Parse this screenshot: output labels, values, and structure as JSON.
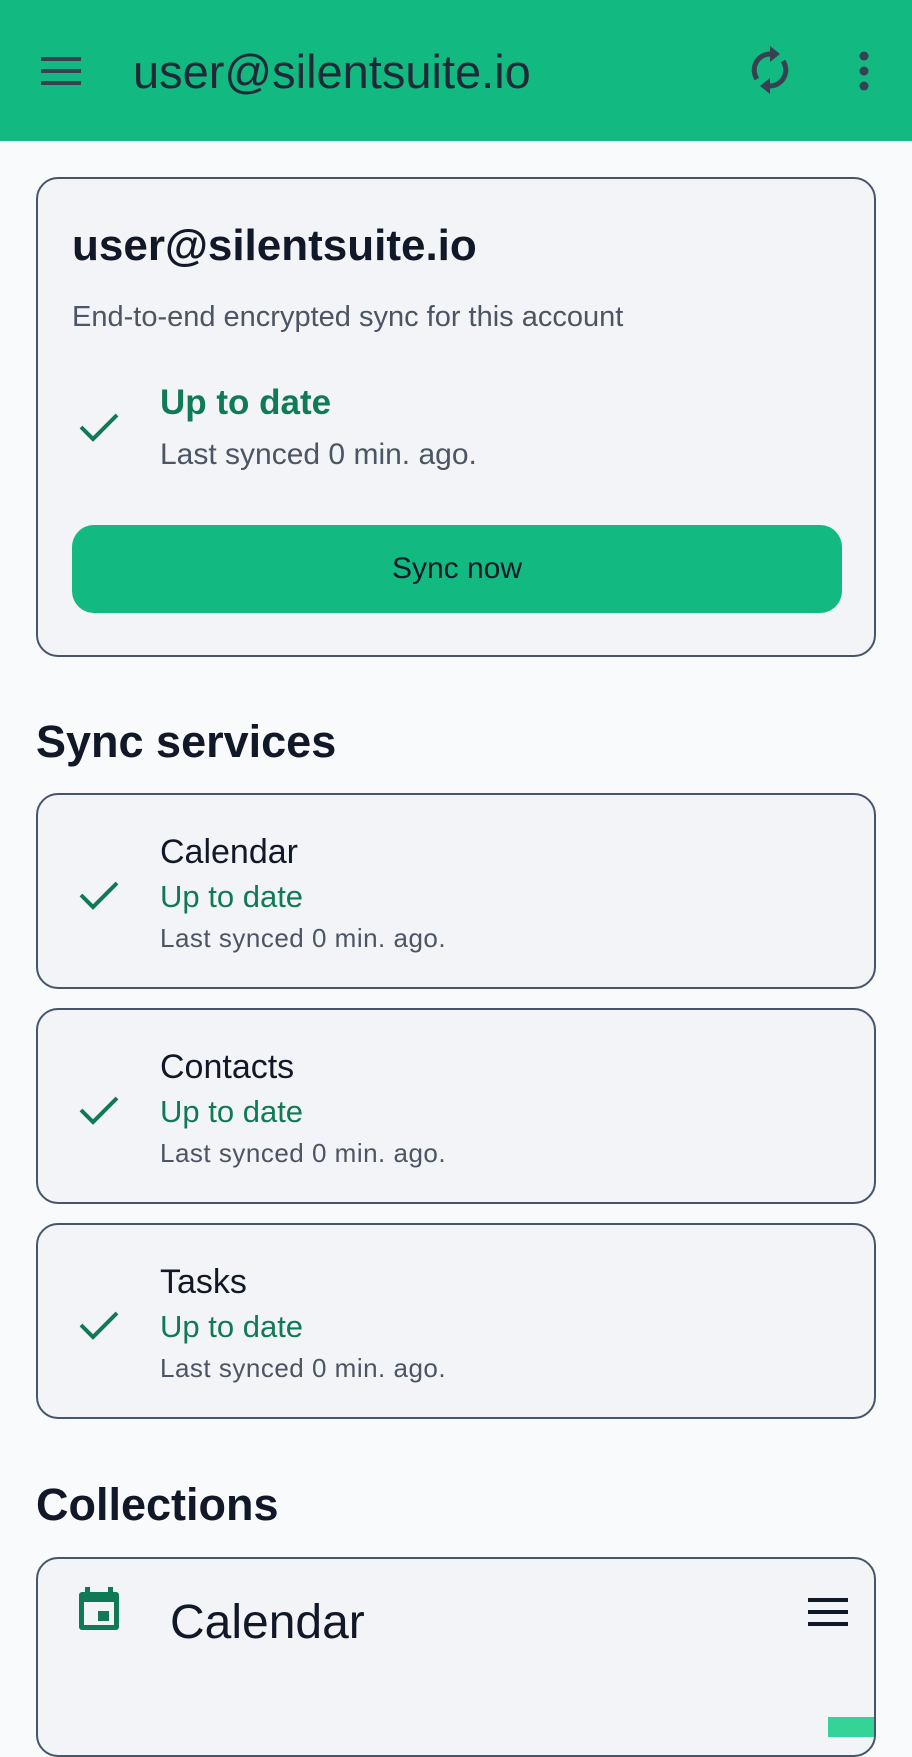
{
  "appbar": {
    "title": "user@silentsuite.io",
    "menu_icon": "hamburger-menu-icon",
    "sync_icon": "sync-icon",
    "more_icon": "more-vert-icon",
    "color": "#12b981"
  },
  "account": {
    "name": "user@silentsuite.io",
    "description": "End-to-end encrypted sync for this account",
    "status": "Up to date",
    "last_synced": "Last synced 0 min. ago.",
    "sync_now_label": "Sync now"
  },
  "services": {
    "heading": "Sync services",
    "items": [
      {
        "name": "Calendar",
        "status": "Up to date",
        "last_synced": "Last synced 0 min. ago."
      },
      {
        "name": "Contacts",
        "status": "Up to date",
        "last_synced": "Last synced 0 min. ago."
      },
      {
        "name": "Tasks",
        "status": "Up to date",
        "last_synced": "Last synced 0 min. ago."
      }
    ]
  },
  "collections": {
    "heading": "Collections",
    "items": [
      {
        "name": "Calendar",
        "icon": "calendar-icon",
        "menu_icon": "hamburger-menu-icon",
        "color": "#34d399"
      }
    ]
  },
  "colors": {
    "accent": "#12b981",
    "status_ok": "#0f7a55"
  }
}
